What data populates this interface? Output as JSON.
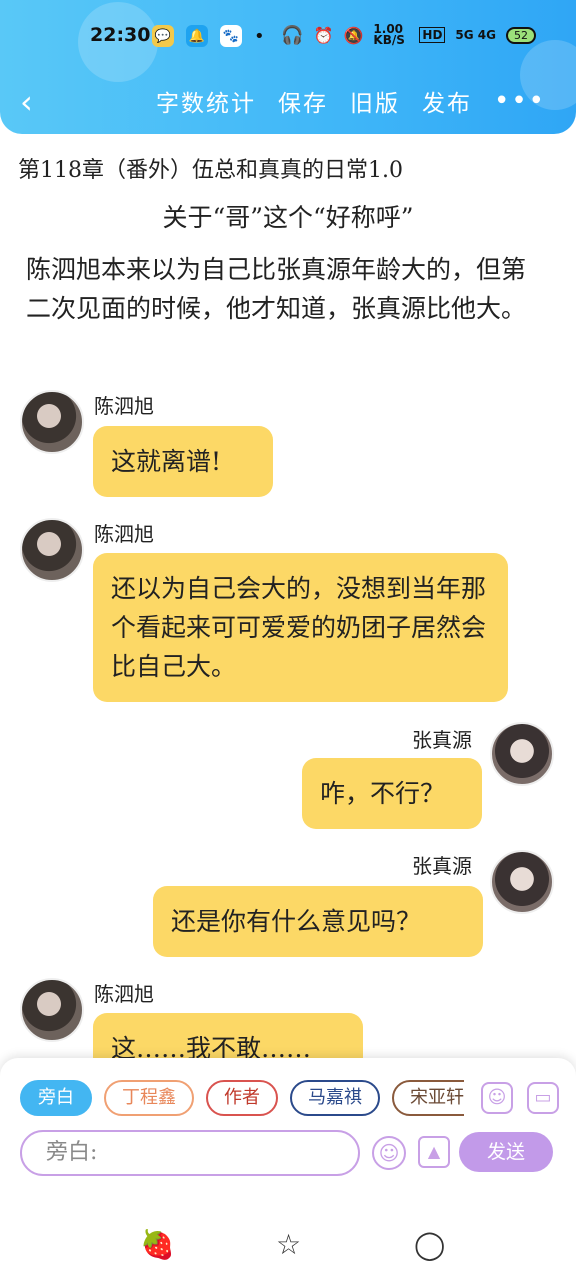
{
  "status_bar": {
    "time": "22:30",
    "net_speed": "1.00 KB/S",
    "network": "5G 4G",
    "battery": "52"
  },
  "nav": {
    "back": "‹",
    "word_count": "字数统计",
    "save": "保存",
    "old_version": "旧版",
    "publish": "发布",
    "more": "•••"
  },
  "story": {
    "chapter_title": "第118章（番外）伍总和真真的日常1.0",
    "subtitle": "关于“哥”这个“好称呼”",
    "narration": "陈泗旭本来以为自己比张真源年龄大的，但第二次见面的时候，他才知道，张真源比他大。"
  },
  "messages": [
    {
      "speaker": "陈泗旭",
      "text": "这就离谱!",
      "side": "left"
    },
    {
      "speaker": "陈泗旭",
      "text": "还以为自己会大的，没想到当年那个看起来可可爱爱的奶团子居然会比自己大。",
      "side": "left"
    },
    {
      "speaker": "张真源",
      "text": "咋，不行？",
      "side": "right"
    },
    {
      "speaker": "张真源",
      "text": "还是你有什么意见吗？",
      "side": "right"
    },
    {
      "speaker": "陈泗旭",
      "text": "这……我不敢……",
      "side": "left"
    }
  ],
  "composer": {
    "roles": [
      "旁白",
      "丁程鑫",
      "作者",
      "马嘉祺",
      "宋亚轩"
    ],
    "role_colors": [
      "#43b6f2",
      "#f0a073",
      "#d9534f",
      "#2b4a8b",
      "#8a5a3c"
    ],
    "placeholder": "旁白:",
    "send_label": "发送",
    "icons": [
      "person-icon",
      "tag-icon",
      "emoji-icon",
      "image-icon"
    ]
  },
  "bottom_nav": {
    "icons": [
      "strawberry-icon",
      "star-icon",
      "leaf-icon"
    ]
  },
  "colors": {
    "header": "#45b9f6",
    "bubble": "#fcd866",
    "accent": "#c29ae9"
  }
}
